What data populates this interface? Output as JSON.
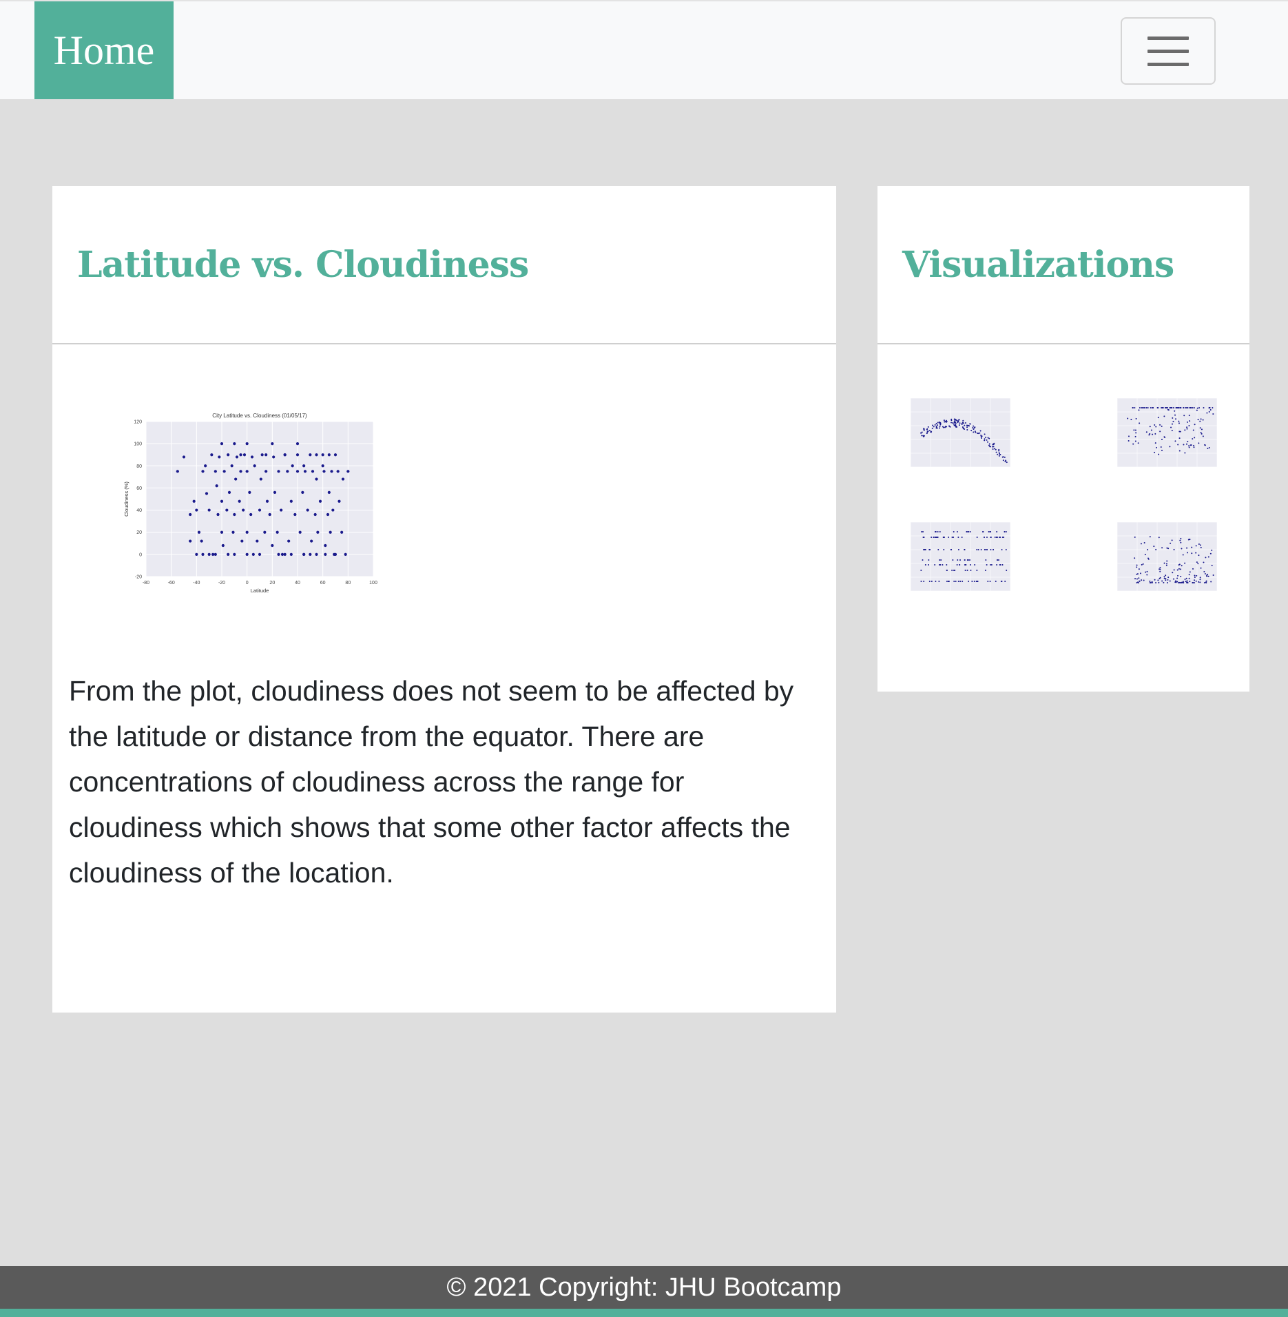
{
  "navbar": {
    "brand": "Home",
    "toggler_icon": "hamburger-icon"
  },
  "main_card": {
    "title": "Latitude vs. Cloudiness",
    "description": "From the plot, cloudiness does not seem to be affected by the latitude or distance from the equator. There are concentrations of cloudiness across the range for cloudiness which shows that some other factor affects the cloudiness of the location."
  },
  "side_card": {
    "title": "Visualizations",
    "thumbnails": [
      {
        "name": "thumb-max-temperature",
        "type": "temperature"
      },
      {
        "name": "thumb-humidity",
        "type": "humidity"
      },
      {
        "name": "thumb-cloudiness",
        "type": "cloudiness"
      },
      {
        "name": "thumb-wind-speed",
        "type": "wind"
      }
    ]
  },
  "footer": {
    "text": "© 2021 Copyright: JHU Bootcamp"
  },
  "colors": {
    "accent": "#52b09a",
    "point": "#1a1a8c",
    "plot_bg": "#eaeaf2"
  },
  "chart_data": {
    "type": "scatter",
    "title": "City Latitude vs. Cloudiness (01/05/17)",
    "xlabel": "Latitude",
    "ylabel": "Cloudiness (%)",
    "xlim": [
      -80,
      100
    ],
    "ylim": [
      -20,
      120
    ],
    "xticks": [
      -80,
      -60,
      -40,
      -20,
      0,
      20,
      40,
      60,
      80,
      100
    ],
    "yticks": [
      -20,
      0,
      20,
      40,
      60,
      80,
      100,
      120
    ],
    "grid": true,
    "series": [
      {
        "points": [
          [
            -55,
            75
          ],
          [
            -50,
            88
          ],
          [
            -45,
            36
          ],
          [
            -42,
            48
          ],
          [
            -40,
            40
          ],
          [
            -38,
            20
          ],
          [
            -36,
            12
          ],
          [
            -35,
            75
          ],
          [
            -33,
            80
          ],
          [
            -32,
            55
          ],
          [
            -30,
            40
          ],
          [
            -28,
            90
          ],
          [
            -27,
            0
          ],
          [
            -25,
            75
          ],
          [
            -24,
            62
          ],
          [
            -23,
            36
          ],
          [
            -22,
            88
          ],
          [
            -20,
            48
          ],
          [
            -20,
            20
          ],
          [
            -19,
            8
          ],
          [
            -18,
            75
          ],
          [
            -16,
            40
          ],
          [
            -15,
            90
          ],
          [
            -14,
            56
          ],
          [
            -12,
            80
          ],
          [
            -11,
            20
          ],
          [
            -10,
            36
          ],
          [
            -9,
            68
          ],
          [
            -8,
            88
          ],
          [
            -6,
            48
          ],
          [
            -5,
            75
          ],
          [
            -4,
            12
          ],
          [
            -3,
            40
          ],
          [
            -2,
            90
          ],
          [
            0,
            75
          ],
          [
            0,
            20
          ],
          [
            2,
            56
          ],
          [
            3,
            36
          ],
          [
            4,
            88
          ],
          [
            5,
            0
          ],
          [
            6,
            80
          ],
          [
            8,
            12
          ],
          [
            10,
            40
          ],
          [
            11,
            68
          ],
          [
            12,
            90
          ],
          [
            14,
            20
          ],
          [
            15,
            75
          ],
          [
            16,
            48
          ],
          [
            18,
            36
          ],
          [
            20,
            8
          ],
          [
            21,
            88
          ],
          [
            22,
            56
          ],
          [
            24,
            20
          ],
          [
            25,
            75
          ],
          [
            27,
            40
          ],
          [
            28,
            0
          ],
          [
            30,
            90
          ],
          [
            32,
            75
          ],
          [
            33,
            12
          ],
          [
            35,
            48
          ],
          [
            36,
            80
          ],
          [
            38,
            36
          ],
          [
            40,
            75
          ],
          [
            40,
            90
          ],
          [
            42,
            20
          ],
          [
            44,
            56
          ],
          [
            45,
            0
          ],
          [
            46,
            75
          ],
          [
            48,
            40
          ],
          [
            50,
            90
          ],
          [
            51,
            12
          ],
          [
            52,
            75
          ],
          [
            54,
            36
          ],
          [
            55,
            68
          ],
          [
            56,
            20
          ],
          [
            58,
            48
          ],
          [
            60,
            90
          ],
          [
            61,
            75
          ],
          [
            62,
            8
          ],
          [
            64,
            36
          ],
          [
            65,
            56
          ],
          [
            66,
            20
          ],
          [
            67,
            75
          ],
          [
            68,
            40
          ],
          [
            69,
            0
          ],
          [
            70,
            90
          ],
          [
            72,
            75
          ],
          [
            73,
            48
          ],
          [
            75,
            20
          ],
          [
            76,
            68
          ],
          [
            78,
            0
          ],
          [
            80,
            75
          ],
          [
            -30,
            0
          ],
          [
            -10,
            0
          ],
          [
            10,
            0
          ],
          [
            30,
            0
          ],
          [
            50,
            0
          ],
          [
            70,
            0
          ],
          [
            -45,
            12
          ],
          [
            20,
            100
          ],
          [
            40,
            100
          ],
          [
            -10,
            100
          ],
          [
            0,
            100
          ],
          [
            -20,
            100
          ],
          [
            30,
            90
          ],
          [
            55,
            90
          ],
          [
            65,
            90
          ],
          [
            -5,
            90
          ],
          [
            15,
            90
          ],
          [
            45,
            80
          ],
          [
            60,
            80
          ],
          [
            -25,
            0
          ],
          [
            -15,
            0
          ],
          [
            0,
            0
          ],
          [
            25,
            0
          ],
          [
            35,
            0
          ],
          [
            55,
            0
          ],
          [
            62,
            0
          ],
          [
            -40,
            0
          ],
          [
            -35,
            0
          ],
          [
            45,
            0
          ]
        ]
      }
    ]
  }
}
